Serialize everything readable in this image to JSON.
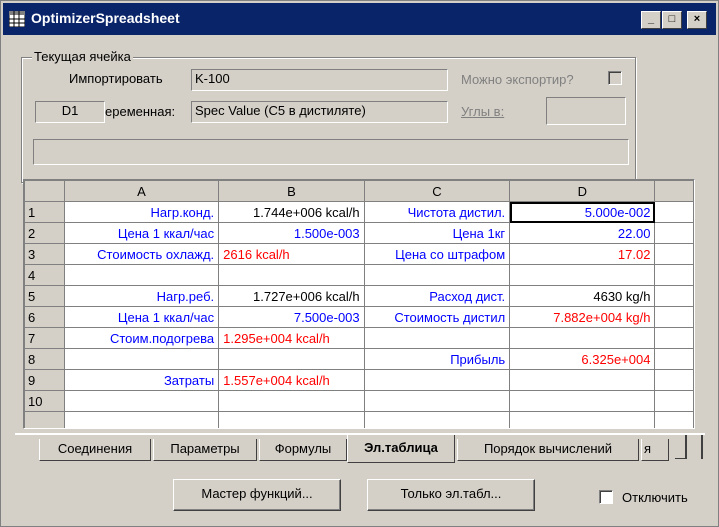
{
  "window": {
    "title": "OptimizerSpreadsheet",
    "min_label": "_",
    "max_label": "□",
    "close_label": "×"
  },
  "current_cell": {
    "legend": "Текущая ячейка",
    "import_label": "Импортировать",
    "import_value": "K-100",
    "export_label": "Можно экспортир?",
    "cell_ref": "D1",
    "variable_label": "еременная:",
    "variable_value": "Spec Value (C5 в дистиляте)",
    "angles_label": "Углы в:",
    "angles_value": "",
    "formula_value": ""
  },
  "grid": {
    "columns": [
      "",
      "A",
      "B",
      "C",
      "D",
      ""
    ],
    "rows": [
      {
        "num": "1",
        "a": "Нагр.конд.",
        "b": "1.744e+006 kcal/h",
        "c": "Чистота дистил.",
        "d": "5.000e-002"
      },
      {
        "num": "2",
        "a": "Цена 1 ккал/час",
        "b": "1.500e-003",
        "c": "Цена 1кг",
        "d": "22.00"
      },
      {
        "num": "3",
        "a": "Стоимость охлажд.",
        "b": "2616 kcal/h",
        "c": "Цена со штрафом",
        "d": "17.02"
      },
      {
        "num": "4",
        "a": "",
        "b": "",
        "c": "",
        "d": ""
      },
      {
        "num": "5",
        "a": "Нагр.реб.",
        "b": "1.727e+006 kcal/h",
        "c": "Расход дист.",
        "d": "4630 kg/h"
      },
      {
        "num": "6",
        "a": "Цена 1 ккал/час",
        "b": "7.500e-003",
        "c": "Стоимость дистил",
        "d": "7.882e+004 kg/h"
      },
      {
        "num": "7",
        "a": "Стоим.подогрева",
        "b": "1.295e+004 kcal/h",
        "c": "",
        "d": ""
      },
      {
        "num": "8",
        "a": "",
        "b": "",
        "c": "Прибыль",
        "d": "6.325e+004"
      },
      {
        "num": "9",
        "a": "Затраты",
        "b": "1.557e+004 kcal/h",
        "c": "",
        "d": ""
      },
      {
        "num": "10",
        "a": "",
        "b": "",
        "c": "",
        "d": ""
      },
      {
        "num": "",
        "a": "",
        "b": "",
        "c": "",
        "d": ""
      }
    ]
  },
  "tabs": [
    "Соединения",
    "Параметры",
    "Формулы",
    "Эл.таблица",
    "Порядок вычислений",
    "я"
  ],
  "active_tab": "Эл.таблица",
  "buttons": {
    "function_wizard": "Мастер функций...",
    "sheet_only": "Только эл.табл..."
  },
  "disable": {
    "label": "Отключить",
    "checked": false
  },
  "colors": {
    "titlebar": "#0a246a",
    "face": "#d4d0c8",
    "blue_text": "#0000ff",
    "red_text": "#ff0000"
  }
}
